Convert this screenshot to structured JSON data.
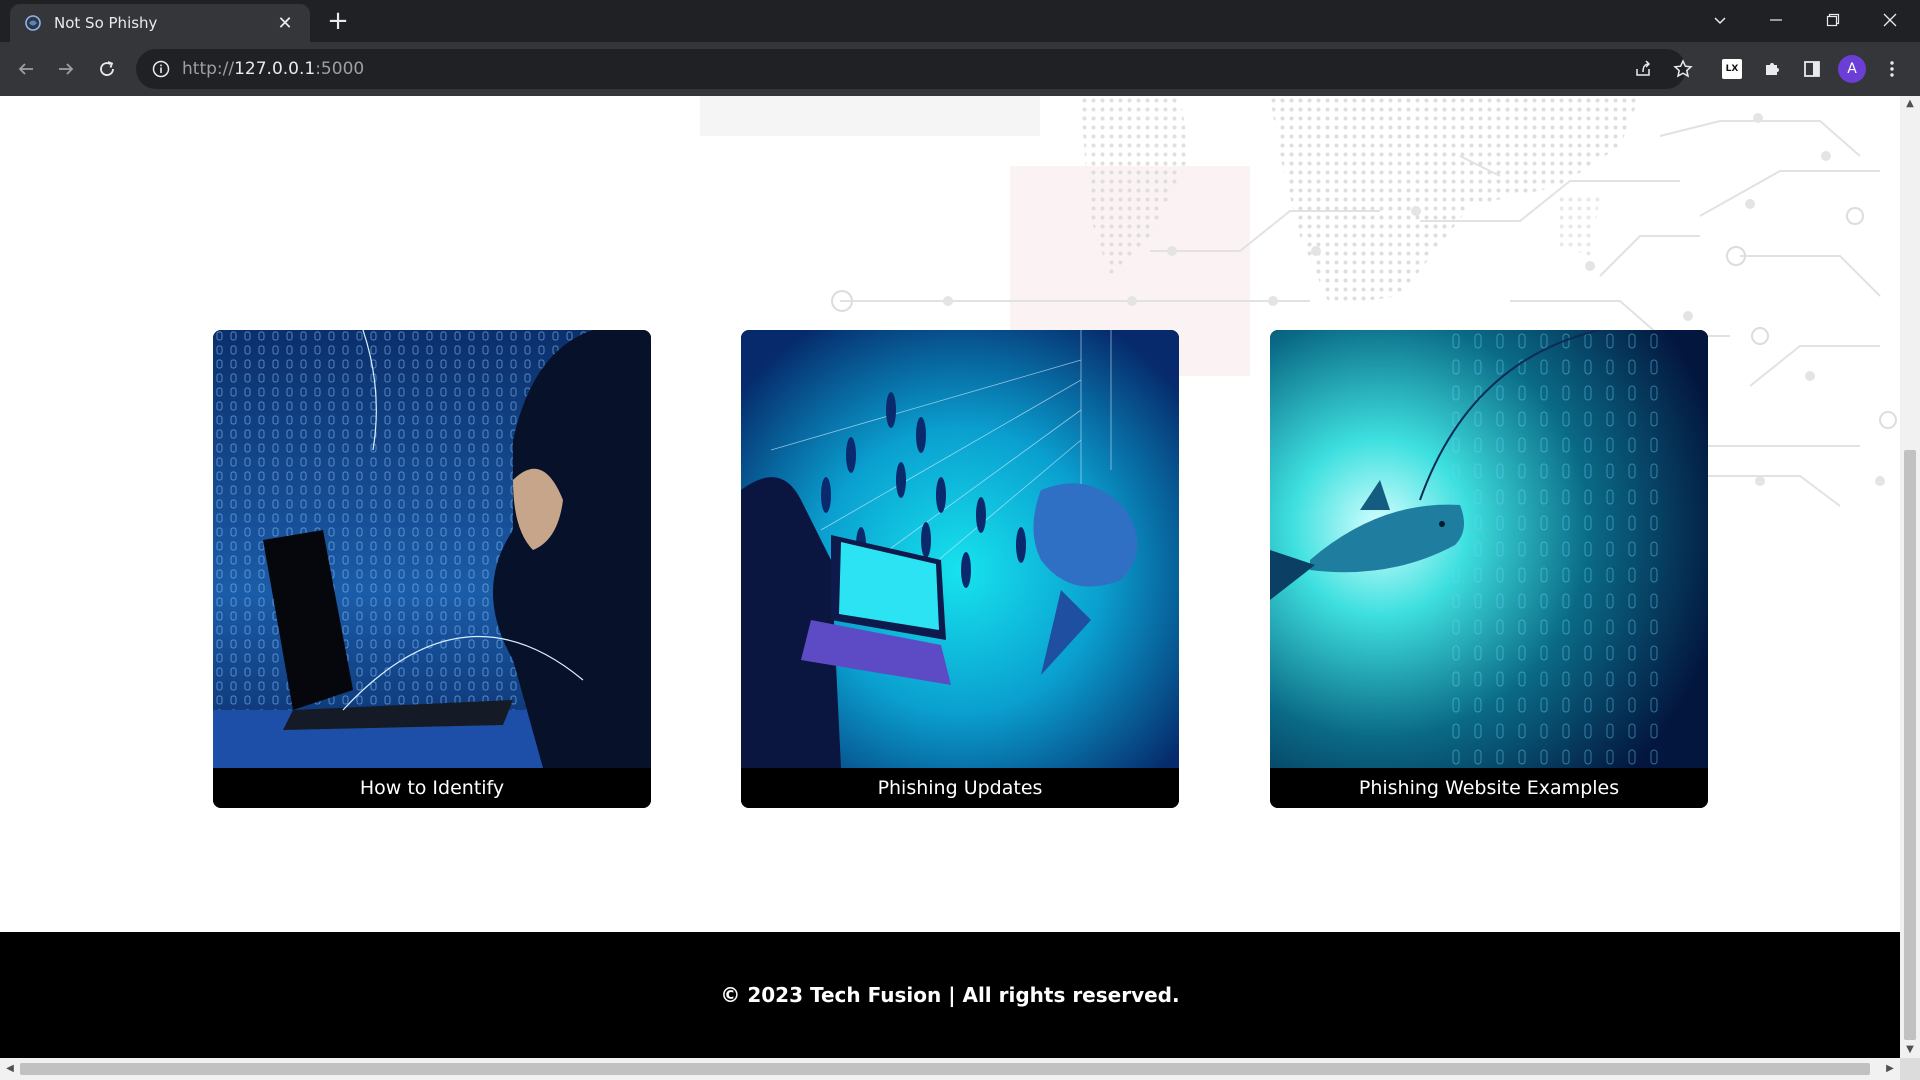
{
  "browser": {
    "tab_title": "Not So Phishy",
    "tab_close": "✕",
    "new_tab": "+",
    "url_scheme": "http://",
    "url_host": "127.0.0.1",
    "url_port": ":5000",
    "profile_initial": "A",
    "extension_label": "LX"
  },
  "cards": [
    {
      "caption": "How to Identify",
      "image": "hacker-hoodie-laptop"
    },
    {
      "caption": "Phishing Updates",
      "image": "hooded-figure-fish-hook"
    },
    {
      "caption": "Phishing Website Examples",
      "image": "fish-on-hook-binary"
    }
  ],
  "footer": {
    "text": "© 2023 Tech Fusion | All rights reserved."
  },
  "colors": {
    "chrome_dark": "#202124",
    "chrome_tab": "#35363a",
    "page_bg": "#ffffff",
    "footer_bg": "#000000",
    "caption_bg": "#000000",
    "profile": "#6b3fd6"
  }
}
